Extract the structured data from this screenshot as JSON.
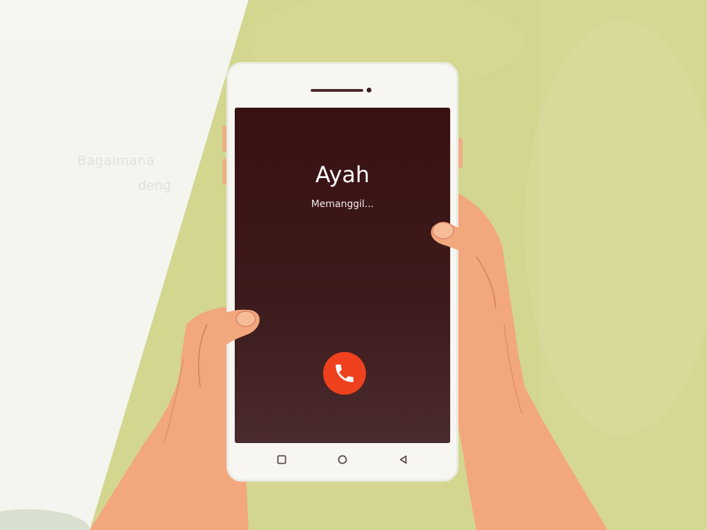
{
  "background": {
    "wall_color": "#d3d68f",
    "paper_color": "#f3f5ee",
    "paper_text_line1": "Bagaimana",
    "paper_text_line2": "deng"
  },
  "call": {
    "caller_name": "Ayah",
    "status": "Memanggil...",
    "end_call_icon": "phone-hangup-icon",
    "end_call_color": "#f0411e"
  },
  "navbar": {
    "items": [
      {
        "icon": "square-recent-apps-icon"
      },
      {
        "icon": "circle-home-icon"
      },
      {
        "icon": "triangle-back-icon"
      }
    ]
  },
  "colors": {
    "screen_top": "#3a1112",
    "screen_bottom": "#4a2b2d",
    "skin": "#f2a77d",
    "skin_line": "#d27d63"
  }
}
